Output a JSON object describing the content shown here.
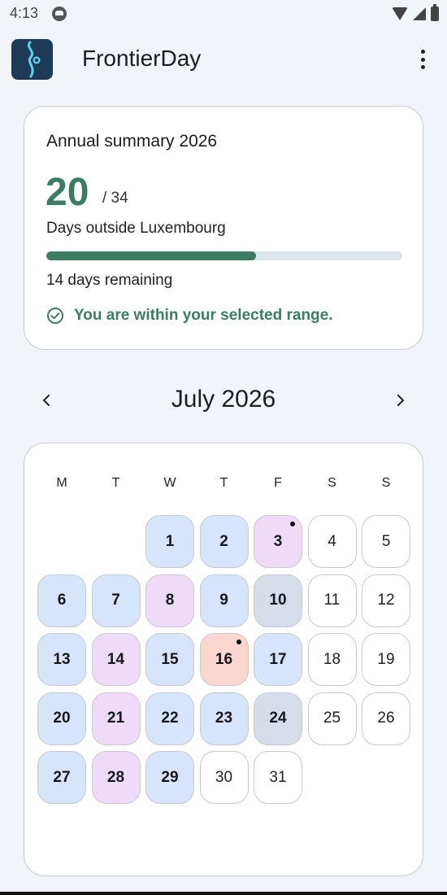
{
  "status_bar": {
    "time": "4:13"
  },
  "app": {
    "title": "FrontierDay"
  },
  "summary": {
    "title": "Annual summary 2026",
    "days_count": "20",
    "days_total": "/ 34",
    "subtitle": "Days outside Luxembourg",
    "progress_fraction": 0.588,
    "remaining": "14 days remaining",
    "status": "You are within your selected range."
  },
  "calendar": {
    "month_title": "July 2026",
    "weekdays": [
      "M",
      "T",
      "W",
      "T",
      "F",
      "S",
      "S"
    ],
    "days": [
      {
        "day": "1",
        "state": "blue",
        "bold": true,
        "dot": false
      },
      {
        "day": "2",
        "state": "blue",
        "bold": true,
        "dot": false
      },
      {
        "day": "3",
        "state": "pink",
        "bold": true,
        "dot": true
      },
      {
        "day": "4",
        "state": "plain",
        "bold": false,
        "dot": false
      },
      {
        "day": "5",
        "state": "plain",
        "bold": false,
        "dot": false
      },
      {
        "day": "6",
        "state": "blue",
        "bold": true,
        "dot": false
      },
      {
        "day": "7",
        "state": "blue",
        "bold": true,
        "dot": false
      },
      {
        "day": "8",
        "state": "pink",
        "bold": true,
        "dot": false
      },
      {
        "day": "9",
        "state": "blue",
        "bold": true,
        "dot": false
      },
      {
        "day": "10",
        "state": "slate",
        "bold": true,
        "dot": false
      },
      {
        "day": "11",
        "state": "plain",
        "bold": false,
        "dot": false
      },
      {
        "day": "12",
        "state": "plain",
        "bold": false,
        "dot": false
      },
      {
        "day": "13",
        "state": "blue",
        "bold": true,
        "dot": false
      },
      {
        "day": "14",
        "state": "pink",
        "bold": true,
        "dot": false
      },
      {
        "day": "15",
        "state": "blue",
        "bold": true,
        "dot": false
      },
      {
        "day": "16",
        "state": "red",
        "bold": true,
        "dot": true
      },
      {
        "day": "17",
        "state": "blue",
        "bold": true,
        "dot": false
      },
      {
        "day": "18",
        "state": "plain",
        "bold": false,
        "dot": false
      },
      {
        "day": "19",
        "state": "plain",
        "bold": false,
        "dot": false
      },
      {
        "day": "20",
        "state": "blue",
        "bold": true,
        "dot": false
      },
      {
        "day": "21",
        "state": "pink",
        "bold": true,
        "dot": false
      },
      {
        "day": "22",
        "state": "blue",
        "bold": true,
        "dot": false
      },
      {
        "day": "23",
        "state": "blue",
        "bold": true,
        "dot": false
      },
      {
        "day": "24",
        "state": "slate",
        "bold": true,
        "dot": false
      },
      {
        "day": "25",
        "state": "plain",
        "bold": false,
        "dot": false
      },
      {
        "day": "26",
        "state": "plain",
        "bold": false,
        "dot": false
      },
      {
        "day": "27",
        "state": "blue",
        "bold": true,
        "dot": false
      },
      {
        "day": "28",
        "state": "pink",
        "bold": true,
        "dot": false
      },
      {
        "day": "29",
        "state": "blue",
        "bold": true,
        "dot": false
      },
      {
        "day": "30",
        "state": "plain",
        "bold": false,
        "dot": false
      },
      {
        "day": "31",
        "state": "plain",
        "bold": false,
        "dot": false
      }
    ]
  },
  "colors": {
    "accent": "#3b7d63",
    "day_blue": "#d7e5fb",
    "day_pink": "#efdbf8",
    "day_slate": "#d5dcea",
    "day_red": "#fbd7d0"
  },
  "icons": {
    "face": "android-face-icon",
    "wifi": "wifi-icon",
    "signal": "signal-icon",
    "battery": "battery-icon",
    "menu": "more-vert-icon",
    "check": "check-circle-icon",
    "prev": "chevron-left-icon",
    "next": "chevron-right-icon"
  }
}
